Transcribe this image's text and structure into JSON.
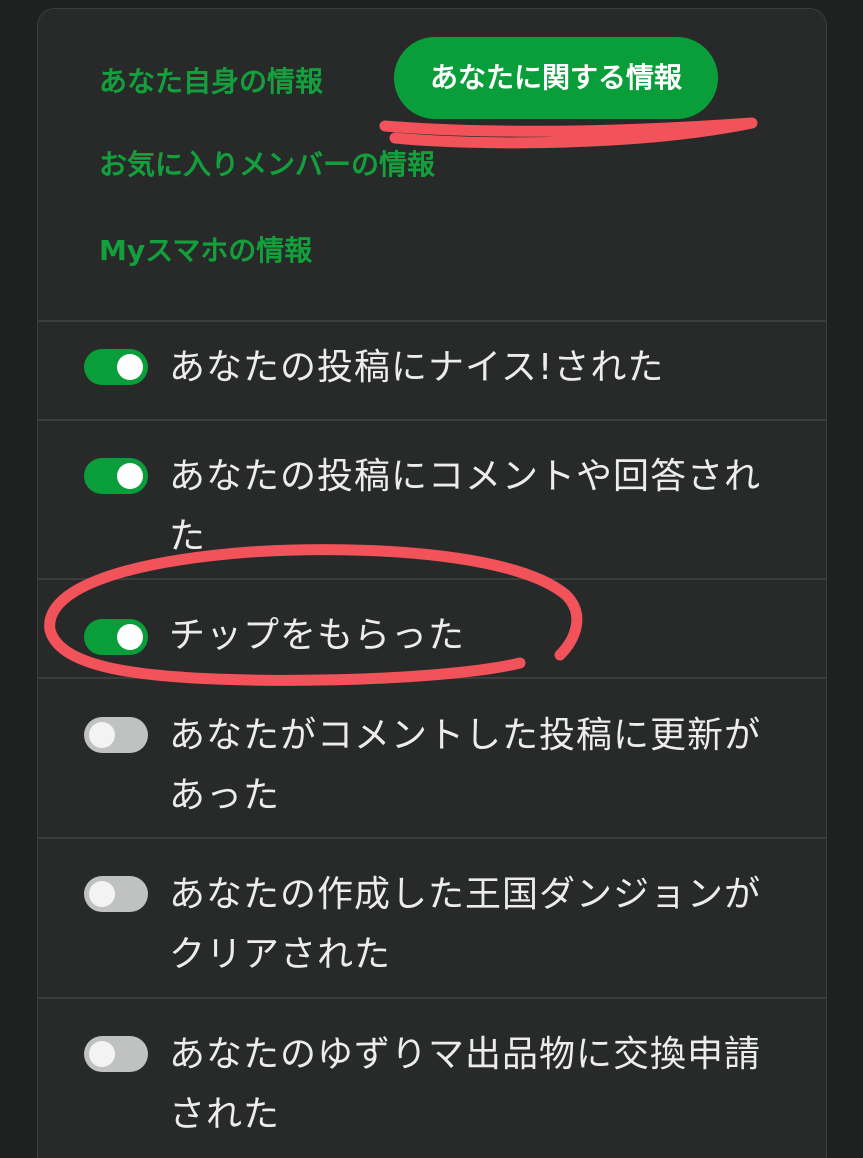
{
  "tabs": [
    {
      "label": "あなた自身の情報",
      "active": false
    },
    {
      "label": "あなたに関する情報",
      "active": true
    },
    {
      "label": "お気に入りメンバーの情報",
      "active": false
    },
    {
      "label": "Myスマホの情報",
      "active": false
    }
  ],
  "settings": [
    {
      "label": "あなたの投稿にナイス!された",
      "enabled": true
    },
    {
      "label": "あなたの投稿にコメントや回答された",
      "enabled": true
    },
    {
      "label": "チップをもらった",
      "enabled": true
    },
    {
      "label": "あなたがコメントした投稿に更新があった",
      "enabled": false
    },
    {
      "label": "あなたの作成した王国ダンジョンがクリアされた",
      "enabled": false
    },
    {
      "label": "あなたのゆずりマ出品物に交換申請された",
      "enabled": false
    }
  ],
  "colors": {
    "accent_green": "#0a9e3a",
    "annotation_red": "#f2525a",
    "toggle_off": "#c0c2c1"
  }
}
